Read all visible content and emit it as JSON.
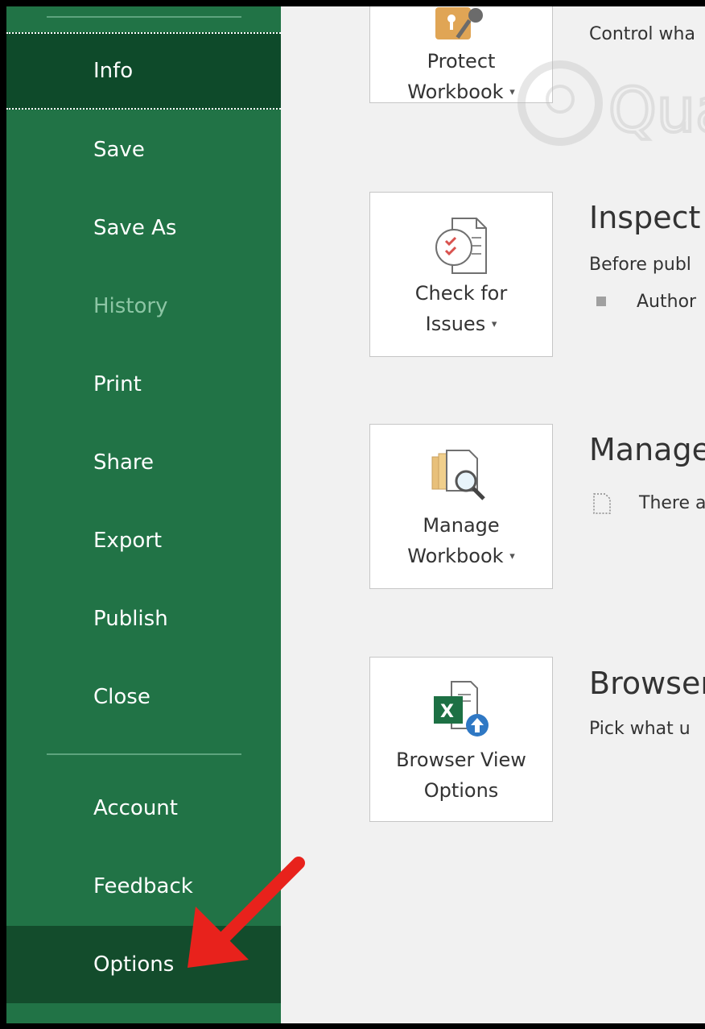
{
  "sidebar": {
    "items": [
      {
        "label": "Info"
      },
      {
        "label": "Save"
      },
      {
        "label": "Save As"
      },
      {
        "label": "History"
      },
      {
        "label": "Print"
      },
      {
        "label": "Share"
      },
      {
        "label": "Export"
      },
      {
        "label": "Publish"
      },
      {
        "label": "Close"
      },
      {
        "label": "Account"
      },
      {
        "label": "Feedback"
      },
      {
        "label": "Options"
      }
    ],
    "colors": {
      "background": "#217346",
      "selected": "#0e4a2a",
      "disabled_text": "#8cc5a4"
    }
  },
  "main": {
    "protect": {
      "line1": "Protect",
      "line2": "Workbook",
      "desc": "Control wha"
    },
    "inspect": {
      "line1": "Check for",
      "line2": "Issues",
      "title": "Inspect",
      "desc": "Before publ",
      "bullet": "Author"
    },
    "manage": {
      "line1": "Manage",
      "line2": "Workbook",
      "title": "Manage",
      "desc": "There a"
    },
    "browser": {
      "line1": "Browser View",
      "line2": "Options",
      "title": "Browser",
      "desc": "Pick what u"
    }
  },
  "icons": [
    "lock-key-icon",
    "check-document-icon",
    "manage-workbook-icon",
    "excel-browser-icon",
    "red-arrow-annotation"
  ],
  "watermark": {
    "text": "Quantrimang"
  },
  "accent_colors": {
    "arrow": "#e8221c",
    "excel_green": "#1d7044"
  }
}
